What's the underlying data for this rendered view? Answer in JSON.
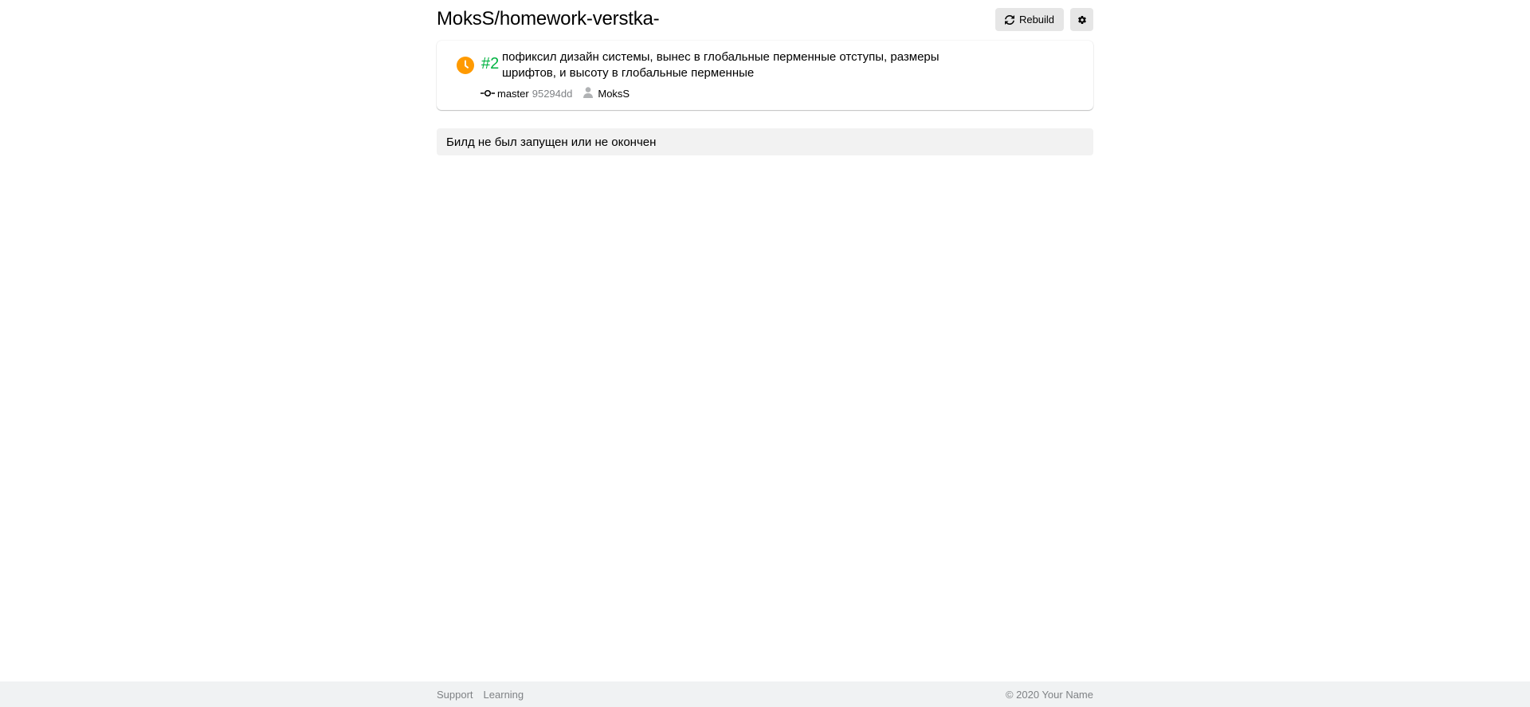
{
  "header": {
    "repo_title": "MoksS/homework-verstka-",
    "rebuild_label": "Rebuild",
    "rebuild_icon": "refresh-icon",
    "settings_icon": "gear-icon"
  },
  "build": {
    "status_icon": "clock-icon",
    "status_color": "#ff9a00",
    "number": "#2",
    "number_color": "#00b341",
    "message": "пофиксил дизайн системы, вынес в глобальные перменные отступы, размеры шрифтов, и высоту в глобальные перменные",
    "branch_icon": "commit-icon",
    "branch": "master",
    "commit_hash": "95294dd",
    "author_icon": "user-icon",
    "author": "MoksS"
  },
  "log": {
    "text": "Билд не был запущен или не окончен"
  },
  "footer": {
    "links": [
      "Support",
      "Learning"
    ],
    "copyright": "© 2020 Your Name"
  }
}
